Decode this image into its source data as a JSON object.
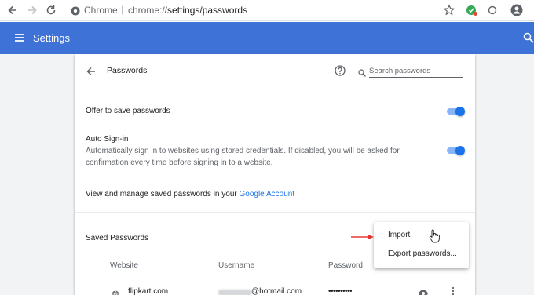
{
  "browser": {
    "site_name": "Chrome",
    "url_scheme": "chrome://",
    "url_path": "settings/passwords"
  },
  "header": {
    "title": "Settings"
  },
  "passwords": {
    "title": "Passwords",
    "search_placeholder": "Search passwords",
    "offer_to_save": {
      "label": "Offer to save passwords",
      "enabled": true
    },
    "auto_signin": {
      "label": "Auto Sign-in",
      "description_line1": "Automatically sign in to websites using stored credentials. If disabled, you will be asked for",
      "description_line2": "confirmation every time before signing in to a website.",
      "enabled": true
    },
    "manage_text": "View and manage saved passwords in your ",
    "manage_link": "Google Account",
    "saved_heading": "Saved Passwords",
    "columns": [
      "Website",
      "Username",
      "Password"
    ],
    "rows": [
      {
        "website": "flipkart.com",
        "username_suffix": "@hotmail.com",
        "password_mask": "••••••••••"
      }
    ]
  },
  "menu": {
    "items": [
      "Import",
      "Export passwords..."
    ]
  },
  "colors": {
    "header_bg": "#3f72d6",
    "accent": "#1a73e8",
    "toggle_track": "#8ab4f8",
    "annotation_arrow": "#e53935"
  }
}
